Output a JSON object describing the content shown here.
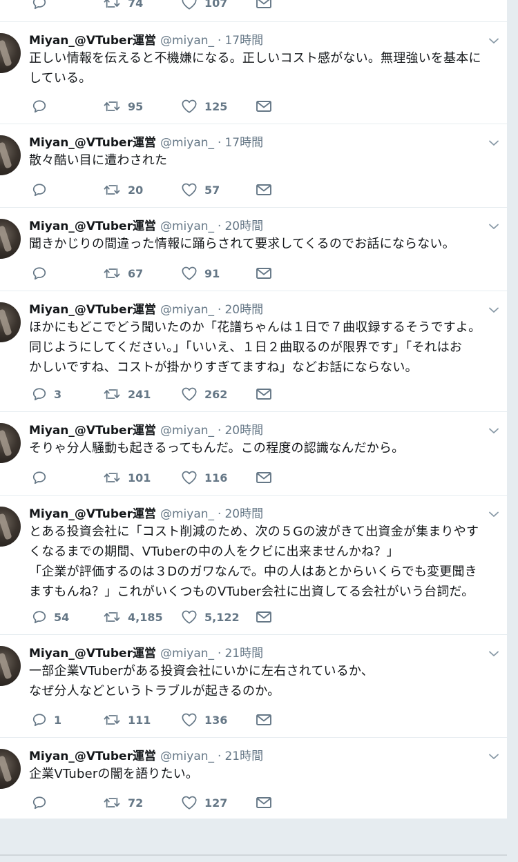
{
  "user": {
    "name": "Miyan_@VTuber運営",
    "handle": "@miyan_",
    "separator": "·"
  },
  "icons": {
    "reply": "reply-icon",
    "retweet": "retweet-icon",
    "like": "heart-icon",
    "dm": "envelope-icon",
    "menu": "chevron-down-icon"
  },
  "colors": {
    "text": "#14171a",
    "secondary": "#657786",
    "background": "#e6ecf0"
  },
  "partial_top": {
    "retweets": "74",
    "likes": "107"
  },
  "tweets": [
    {
      "time": "17時間",
      "text": "正しい情報を伝えると不機嫌になる。正しいコスト感がない。無理強いを基本に\nしている。",
      "replies": "",
      "retweets": "95",
      "likes": "125"
    },
    {
      "time": "17時間",
      "text": "散々酷い目に遭わされた",
      "replies": "",
      "retweets": "20",
      "likes": "57"
    },
    {
      "time": "20時間",
      "text": "聞きかじりの間違った情報に踊らされて要求してくるのでお話にならない。",
      "replies": "",
      "retweets": "67",
      "likes": "91"
    },
    {
      "time": "20時間",
      "text": "ほかにもどこでどう聞いたのか「花譜ちゃんは１日で７曲収録するそうですよ。\n同じようにしてください。」「いいえ、１日２曲取るのが限界です」「それはお\nかしいですね、コストが掛かりすぎてますね」などお話にならない。",
      "replies": "3",
      "retweets": "241",
      "likes": "262"
    },
    {
      "time": "20時間",
      "text": "そりゃ分人騒動も起きるってもんだ。この程度の認識なんだから。",
      "replies": "",
      "retweets": "101",
      "likes": "116"
    },
    {
      "time": "20時間",
      "text": "とある投資会社に「コスト削減のため、次の５Gの波がきて出資金が集まりやす\nくなるまでの期間、VTuberの中の人をクビに出来ませんかね？」\n「企業が評価するのは３Dのガワなんで。中の人はあとからいくらでも変更聞き\nますもんね？」これがいくつものVTuber会社に出資してる会社がいう台詞だ。",
      "replies": "54",
      "retweets": "4,185",
      "likes": "5,122"
    },
    {
      "time": "21時間",
      "text": "一部企業VTuberがある投資会社にいかに左右されているか、\nなぜ分人などというトラブルが起きるのか。",
      "replies": "1",
      "retweets": "111",
      "likes": "136"
    },
    {
      "time": "21時間",
      "text": "企業VTuberの闇を語りたい。",
      "replies": "",
      "retweets": "72",
      "likes": "127"
    }
  ]
}
